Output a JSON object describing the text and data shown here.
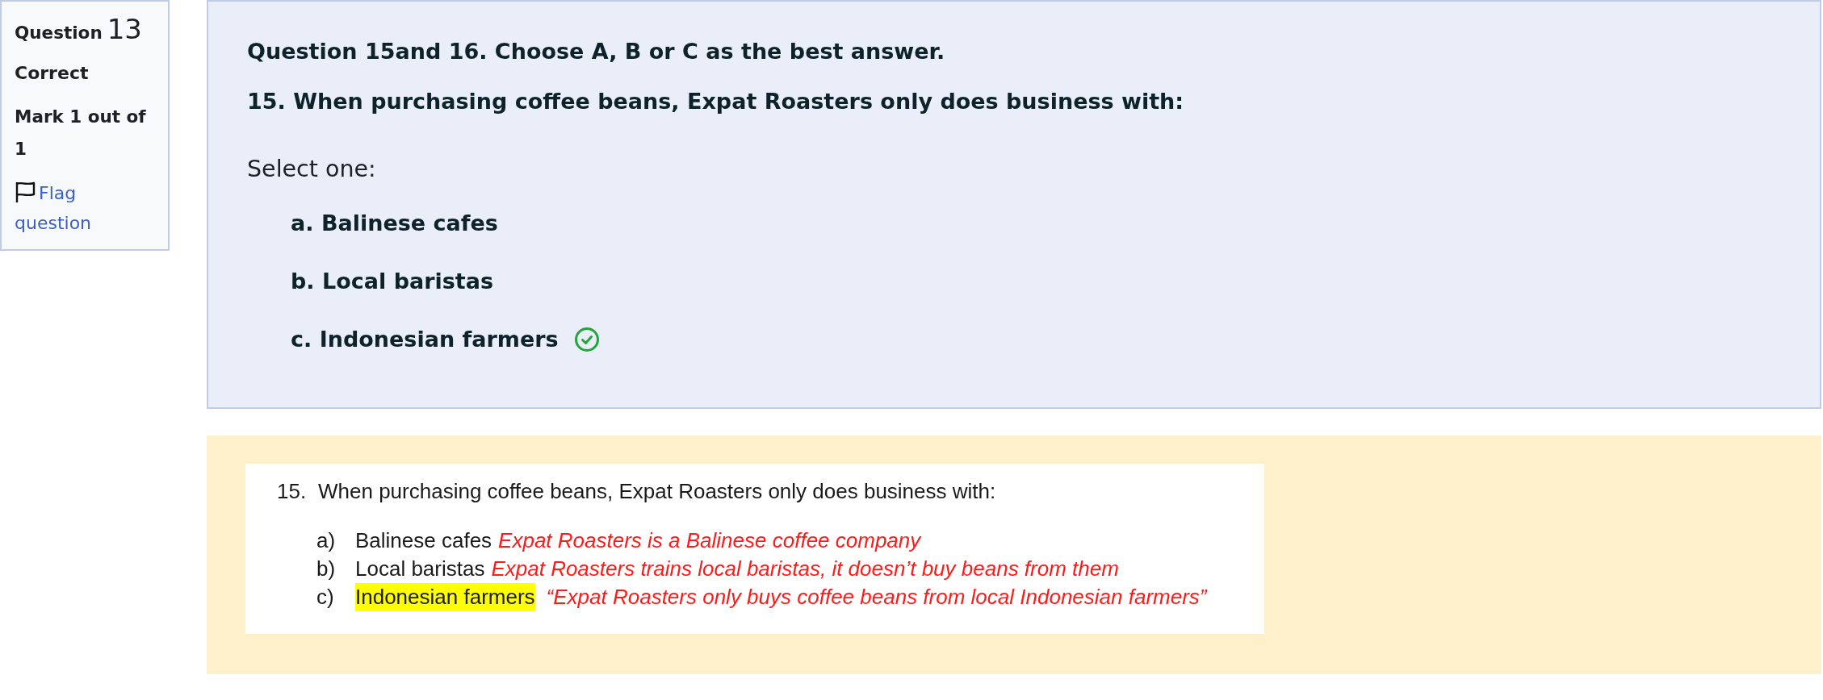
{
  "question_info": {
    "label": "Question",
    "number": "13",
    "status": "Correct",
    "mark": "Mark 1 out of 1",
    "flag_link": "Flag question"
  },
  "question": {
    "instruction": "Question 15and 16. Choose A, B or C as the best answer.",
    "text": "15. When purchasing coffee beans, Expat Roasters only does business with:",
    "prompt": "Select one:",
    "options": [
      {
        "label": "a.",
        "text": "Balinese cafes",
        "correct": false
      },
      {
        "label": "b.",
        "text": "Local baristas",
        "correct": false
      },
      {
        "label": "c.",
        "text": "Indonesian farmers",
        "correct": true
      }
    ]
  },
  "feedback": {
    "document": {
      "number": "15.",
      "question": "When purchasing coffee beans, Expat Roasters only does business with:",
      "options": [
        {
          "label": "a)",
          "text": "Balinese cafes",
          "highlighted": false,
          "note": "Expat Roasters is a Balinese coffee company"
        },
        {
          "label": "b)",
          "text": "Local baristas",
          "highlighted": false,
          "note": "Expat Roasters trains local baristas, it doesn’t buy beans from them"
        },
        {
          "label": "c)",
          "text": "Indonesian farmers",
          "highlighted": true,
          "note": "“Expat Roasters only buys coffee beans from local Indonesian farmers”"
        }
      ]
    }
  }
}
